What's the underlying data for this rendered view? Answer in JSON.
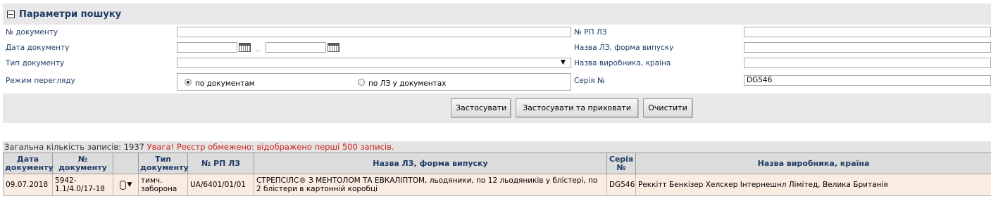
{
  "panel": {
    "title": "Параметри пошуку"
  },
  "form": {
    "doc_number_label": "№ документу",
    "doc_date_label": "Дата документу",
    "doc_type_label": "Тип документу",
    "view_mode_label": "Режим перегляду",
    "date_separator": "..",
    "rp_label": "№ РП ЛЗ",
    "name_label": "Назва ЛЗ, форма випуску",
    "manufacturer_label": "Назва виробника, країна",
    "series_label": "Серія №",
    "series_value": "DG546",
    "radio_by_docs": "по документам",
    "radio_by_lz": "по ЛЗ у документах",
    "radio_selected": "by_docs"
  },
  "buttons": {
    "apply": "Застосувати",
    "apply_hide": "Застосувати та приховати",
    "clear": "Очистити"
  },
  "results": {
    "count_text": "Загальна кількість записів: 1937",
    "warning": "Увага! Реєстр обмежено: відображено перші 500 записів.",
    "headers": {
      "date": "Дата документу",
      "number": "№ документу",
      "type": "Тип документу",
      "rp": "№ РП ЛЗ",
      "name": "Назва ЛЗ, форма випуску",
      "series": "Серія №",
      "manufacturer": "Назва виробника, країна"
    },
    "rows": [
      {
        "date": "09.07.2018",
        "number": "5942-1.1/4.0/17-18",
        "type": "тимч. заборона",
        "rp": "UA/6401/01/01",
        "name": "СТРЕПСІЛС® З МЕНТОЛОМ ТА ЕВКАЛІПТОМ, льодяники, по 12 льодяників у блістері, по 2 блістери в картонній коробці",
        "series": "DG546",
        "manufacturer": "Реккітт Бенкізер Хелскер Інтернешнл Лімітед, Велика Британія"
      }
    ]
  },
  "icons": {
    "calendar": "calendar-icon",
    "attachment": "paperclip-icon",
    "dropdown": "chevron-down-icon",
    "collapse": "minus-square-icon"
  }
}
